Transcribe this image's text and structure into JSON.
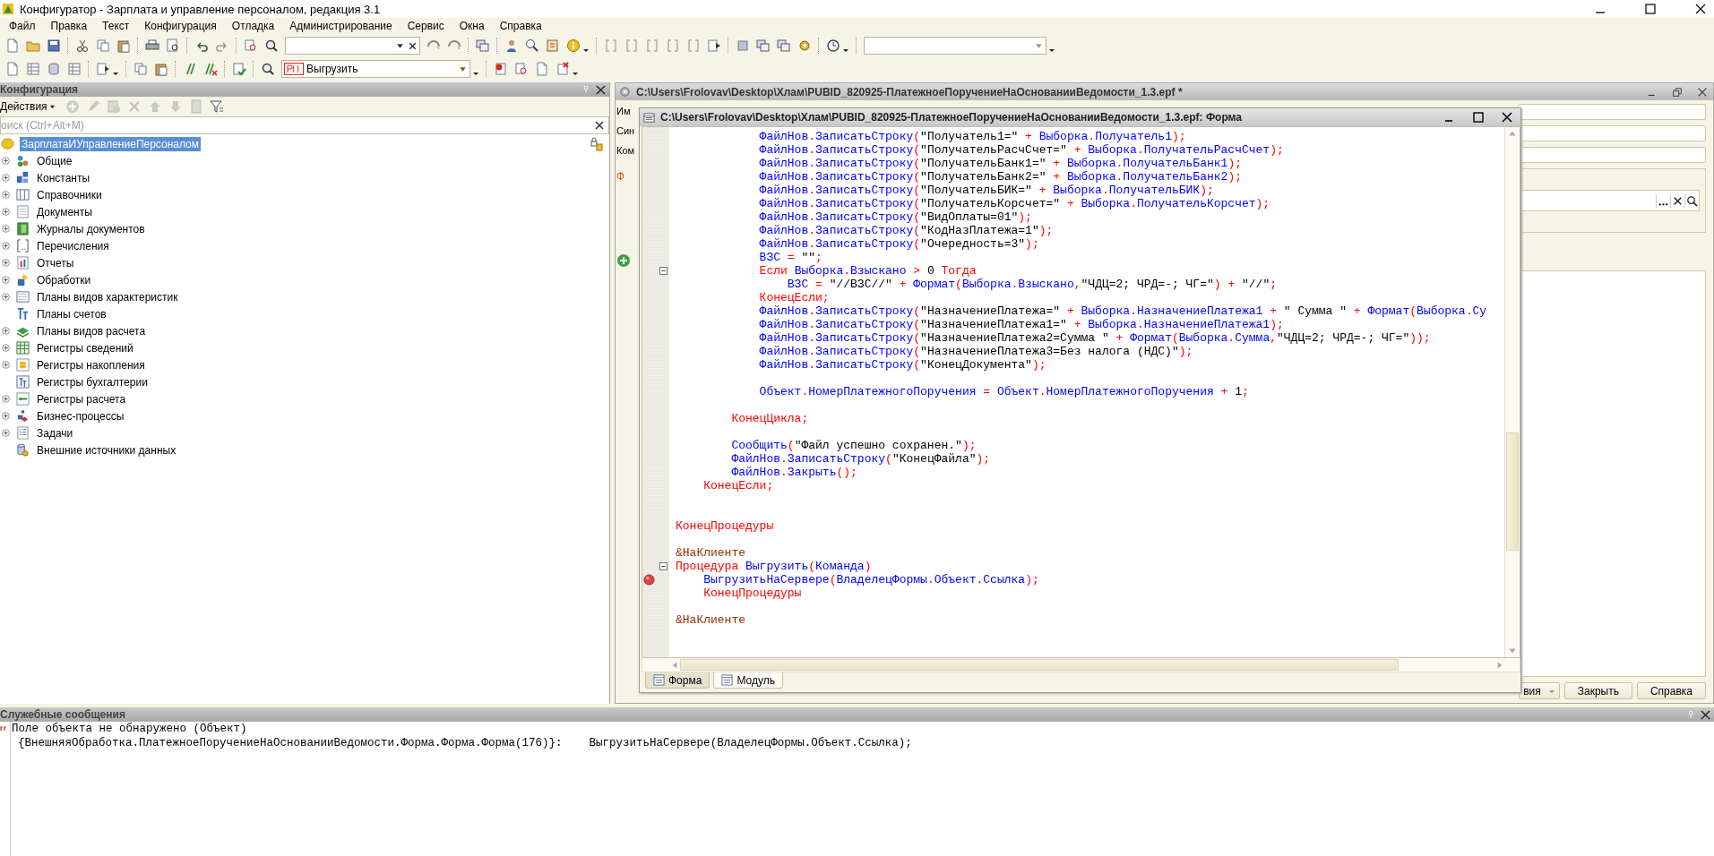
{
  "window": {
    "title": "Конфигуратор - Зарплата и управление персоналом, редакция 3.1"
  },
  "menu": [
    "Файл",
    "Правка",
    "Текст",
    "Конфигурация",
    "Отладка",
    "Администрирование",
    "Сервис",
    "Окна",
    "Справка"
  ],
  "toolbar": {
    "command_combo": {
      "value": "Выгрузить"
    }
  },
  "config_panel": {
    "title": "Конфигурация",
    "actions_label": "Действия",
    "search_placeholder": "оиск (Ctrl+Alt+M)",
    "tree": [
      {
        "label": "ЗарплатаИУправлениеПерсоналом",
        "selected": true,
        "children": [
          {
            "label": "Общие",
            "expandable": true,
            "selected": false
          },
          {
            "label": "Константы",
            "expandable": true,
            "selected": false
          },
          {
            "label": "Справочники",
            "expandable": true,
            "selected": false
          },
          {
            "label": "Документы",
            "expandable": true,
            "selected": false
          },
          {
            "label": "Журналы документов",
            "expandable": true,
            "selected": false
          },
          {
            "label": "Перечисления",
            "expandable": true,
            "selected": false
          },
          {
            "label": "Отчеты",
            "expandable": true,
            "selected": false
          },
          {
            "label": "Обработки",
            "expandable": true,
            "selected": false
          },
          {
            "label": "Планы видов характеристик",
            "expandable": true,
            "selected": false
          },
          {
            "label": "Планы счетов",
            "expandable": false,
            "selected": false
          },
          {
            "label": "Планы видов расчета",
            "expandable": true,
            "selected": false
          },
          {
            "label": "Регистры сведений",
            "expandable": true,
            "selected": false
          },
          {
            "label": "Регистры накопления",
            "expandable": true,
            "selected": false
          },
          {
            "label": "Регистры бухгалтерии",
            "expandable": false,
            "selected": false
          },
          {
            "label": "Регистры расчета",
            "expandable": true,
            "selected": false
          },
          {
            "label": "Бизнес-процессы",
            "expandable": true,
            "selected": false
          },
          {
            "label": "Задачи",
            "expandable": true,
            "selected": false
          },
          {
            "label": "Внешние источники данных",
            "expandable": false,
            "selected": false
          }
        ]
      }
    ]
  },
  "processing_window": {
    "title": "C:\\Users\\Frolovav\\Desktop\\Хлам\\PUBID_820925-ПлатежноеПоручениеНаОснованииВедомости_1.3.epf *",
    "labels": [
      "Им",
      "Син",
      "Ком"
    ],
    "group_title": "Ф",
    "buttons": [
      {
        "label": "вия",
        "kind": "dropdown"
      },
      {
        "label": "Закрыть",
        "kind": "plain"
      },
      {
        "label": "Справка",
        "kind": "plain"
      }
    ]
  },
  "module_window": {
    "title": "C:\\Users\\Frolovav\\Desktop\\Хлам\\PUBID_820925-ПлатежноеПоручениеНаОснованииВедомости_1.3.epf: Форма",
    "tabs": [
      {
        "label": "Форма",
        "selected": false
      },
      {
        "label": "Модуль",
        "selected": true
      }
    ],
    "code": [
      {
        "kind": "code",
        "tokens": [
          {
            "text": "            ФайлНов.ЗаписатьСтроку",
            "kind": "id"
          },
          {
            "text": "(",
            "kind": "op"
          },
          {
            "text": "\"Получатель1=\"",
            "kind": "str"
          },
          {
            "text": " + ",
            "kind": "op"
          },
          {
            "text": "Выборка.Получатель1",
            "kind": "id"
          },
          {
            "text": ");",
            "kind": "op"
          }
        ]
      },
      {
        "kind": "code",
        "tokens": [
          {
            "text": "            ФайлНов.ЗаписатьСтроку",
            "kind": "id"
          },
          {
            "text": "(",
            "kind": "op"
          },
          {
            "text": "\"ПолучательРасчСчет=\"",
            "kind": "str"
          },
          {
            "text": " + ",
            "kind": "op"
          },
          {
            "text": "Выборка.ПолучательРасчСчет",
            "kind": "id"
          },
          {
            "text": ");",
            "kind": "op"
          }
        ]
      },
      {
        "kind": "code",
        "tokens": [
          {
            "text": "            ФайлНов.ЗаписатьСтроку",
            "kind": "id"
          },
          {
            "text": "(",
            "kind": "op"
          },
          {
            "text": "\"ПолучательБанк1=\"",
            "kind": "str"
          },
          {
            "text": " + ",
            "kind": "op"
          },
          {
            "text": "Выборка.ПолучательБанк1",
            "kind": "id"
          },
          {
            "text": ");",
            "kind": "op"
          }
        ]
      },
      {
        "kind": "code",
        "tokens": [
          {
            "text": "            ФайлНов.ЗаписатьСтроку",
            "kind": "id"
          },
          {
            "text": "(",
            "kind": "op"
          },
          {
            "text": "\"ПолучательБанк2=\"",
            "kind": "str"
          },
          {
            "text": " + ",
            "kind": "op"
          },
          {
            "text": "Выборка.ПолучательБанк2",
            "kind": "id"
          },
          {
            "text": ");",
            "kind": "op"
          }
        ]
      },
      {
        "kind": "code",
        "tokens": [
          {
            "text": "            ФайлНов.ЗаписатьСтроку",
            "kind": "id"
          },
          {
            "text": "(",
            "kind": "op"
          },
          {
            "text": "\"ПолучательБИК=\"",
            "kind": "str"
          },
          {
            "text": " + ",
            "kind": "op"
          },
          {
            "text": "Выборка.ПолучательБИК",
            "kind": "id"
          },
          {
            "text": ");",
            "kind": "op"
          }
        ]
      },
      {
        "kind": "code",
        "tokens": [
          {
            "text": "            ФайлНов.ЗаписатьСтроку",
            "kind": "id"
          },
          {
            "text": "(",
            "kind": "op"
          },
          {
            "text": "\"ПолучательКорсчет=\"",
            "kind": "str"
          },
          {
            "text": " + ",
            "kind": "op"
          },
          {
            "text": "Выборка.ПолучательКорсчет",
            "kind": "id"
          },
          {
            "text": ");",
            "kind": "op"
          }
        ]
      },
      {
        "kind": "code",
        "tokens": [
          {
            "text": "            ФайлНов.ЗаписатьСтроку",
            "kind": "id"
          },
          {
            "text": "(",
            "kind": "op"
          },
          {
            "text": "\"ВидОплаты=01\"",
            "kind": "str"
          },
          {
            "text": ");",
            "kind": "op"
          }
        ]
      },
      {
        "kind": "code",
        "tokens": [
          {
            "text": "            ФайлНов.ЗаписатьСтроку",
            "kind": "id"
          },
          {
            "text": "(",
            "kind": "op"
          },
          {
            "text": "\"КодНазПлатежа=1\"",
            "kind": "str"
          },
          {
            "text": ");",
            "kind": "op"
          }
        ]
      },
      {
        "kind": "code",
        "tokens": [
          {
            "text": "            ФайлНов.ЗаписатьСтроку",
            "kind": "id"
          },
          {
            "text": "(",
            "kind": "op"
          },
          {
            "text": "\"Очередность=3\"",
            "kind": "str"
          },
          {
            "text": ");",
            "kind": "op"
          }
        ]
      },
      {
        "kind": "code",
        "tokens": [
          {
            "text": "            ВЗС",
            "kind": "id"
          },
          {
            "text": " = ",
            "kind": "op"
          },
          {
            "text": "\"\"",
            "kind": "str"
          },
          {
            "text": ";",
            "kind": "op"
          }
        ]
      },
      {
        "kind": "code",
        "collapsible": true,
        "tokens": [
          {
            "text": "            Если ",
            "kind": "kw"
          },
          {
            "text": "Выборка.Взыскано",
            "kind": "id"
          },
          {
            "text": " > ",
            "kind": "op"
          },
          {
            "text": "0",
            "kind": "num"
          },
          {
            "text": " Тогда",
            "kind": "kw"
          }
        ]
      },
      {
        "kind": "code",
        "tokens": [
          {
            "text": "                ВЗС",
            "kind": "id"
          },
          {
            "text": " = ",
            "kind": "op"
          },
          {
            "text": "\"//ВЗС//\"",
            "kind": "str"
          },
          {
            "text": " + ",
            "kind": "op"
          },
          {
            "text": "Формат",
            "kind": "id"
          },
          {
            "text": "(",
            "kind": "op"
          },
          {
            "text": "Выборка.Взыскано",
            "kind": "id"
          },
          {
            "text": ",",
            "kind": "op"
          },
          {
            "text": "\"ЧДЦ=2; ЧРД=-; ЧГ=\"",
            "kind": "str"
          },
          {
            "text": ") + ",
            "kind": "op"
          },
          {
            "text": "\"//\"",
            "kind": "str"
          },
          {
            "text": ";",
            "kind": "op"
          }
        ]
      },
      {
        "kind": "code",
        "tokens": [
          {
            "text": "            КонецЕсли;",
            "kind": "kw"
          }
        ]
      },
      {
        "kind": "code",
        "tokens": [
          {
            "text": "            ФайлНов.ЗаписатьСтроку",
            "kind": "id"
          },
          {
            "text": "(",
            "kind": "op"
          },
          {
            "text": "\"НазначениеПлатежа=\"",
            "kind": "str"
          },
          {
            "text": " + ",
            "kind": "op"
          },
          {
            "text": "Выборка.НазначениеПлатежа1",
            "kind": "id"
          },
          {
            "text": " + ",
            "kind": "op"
          },
          {
            "text": "\" Сумма \"",
            "kind": "str"
          },
          {
            "text": " + ",
            "kind": "op"
          },
          {
            "text": "Формат",
            "kind": "id"
          },
          {
            "text": "(",
            "kind": "op"
          },
          {
            "text": "Выборка.Су",
            "kind": "id"
          }
        ]
      },
      {
        "kind": "code",
        "tokens": [
          {
            "text": "            ФайлНов.ЗаписатьСтроку",
            "kind": "id"
          },
          {
            "text": "(",
            "kind": "op"
          },
          {
            "text": "\"НазначениеПлатежа1=\"",
            "kind": "str"
          },
          {
            "text": " + ",
            "kind": "op"
          },
          {
            "text": "Выборка.НазначениеПлатежа1",
            "kind": "id"
          },
          {
            "text": ");",
            "kind": "op"
          }
        ]
      },
      {
        "kind": "code",
        "tokens": [
          {
            "text": "            ФайлНов.ЗаписатьСтроку",
            "kind": "id"
          },
          {
            "text": "(",
            "kind": "op"
          },
          {
            "text": "\"НазначениеПлатежа2=Сумма \"",
            "kind": "str"
          },
          {
            "text": " + ",
            "kind": "op"
          },
          {
            "text": "Формат",
            "kind": "id"
          },
          {
            "text": "(",
            "kind": "op"
          },
          {
            "text": "Выборка.Сумма",
            "kind": "id"
          },
          {
            "text": ",",
            "kind": "op"
          },
          {
            "text": "\"ЧДЦ=2; ЧРД=-; ЧГ=\"",
            "kind": "str"
          },
          {
            "text": "));",
            "kind": "op"
          }
        ]
      },
      {
        "kind": "code",
        "tokens": [
          {
            "text": "            ФайлНов.ЗаписатьСтроку",
            "kind": "id"
          },
          {
            "text": "(",
            "kind": "op"
          },
          {
            "text": "\"НазначениеПлатежа3=Без налога (НДС)\"",
            "kind": "str"
          },
          {
            "text": ");",
            "kind": "op"
          }
        ]
      },
      {
        "kind": "code",
        "tokens": [
          {
            "text": "            ФайлНов.ЗаписатьСтроку",
            "kind": "id"
          },
          {
            "text": "(",
            "kind": "op"
          },
          {
            "text": "\"КонецДокумента\"",
            "kind": "str"
          },
          {
            "text": ");",
            "kind": "op"
          }
        ]
      },
      {
        "kind": "blank"
      },
      {
        "kind": "code",
        "tokens": [
          {
            "text": "            Объект.НомерПлатежногоПоручения",
            "kind": "id"
          },
          {
            "text": " = ",
            "kind": "op"
          },
          {
            "text": "Объект.НомерПлатежногоПоручения",
            "kind": "id"
          },
          {
            "text": " + ",
            "kind": "op"
          },
          {
            "text": "1",
            "kind": "num"
          },
          {
            "text": ";",
            "kind": "op"
          }
        ]
      },
      {
        "kind": "blank"
      },
      {
        "kind": "code",
        "tokens": [
          {
            "text": "        КонецЦикла;",
            "kind": "kw"
          }
        ]
      },
      {
        "kind": "blank"
      },
      {
        "kind": "code",
        "tokens": [
          {
            "text": "        Сообщить",
            "kind": "id"
          },
          {
            "text": "(",
            "kind": "op"
          },
          {
            "text": "\"Файл успешно сохранен.\"",
            "kind": "str"
          },
          {
            "text": ");",
            "kind": "op"
          }
        ]
      },
      {
        "kind": "code",
        "tokens": [
          {
            "text": "        ФайлНов.ЗаписатьСтроку",
            "kind": "id"
          },
          {
            "text": "(",
            "kind": "op"
          },
          {
            "text": "\"КонецФайла\"",
            "kind": "str"
          },
          {
            "text": ");",
            "kind": "op"
          }
        ]
      },
      {
        "kind": "code",
        "tokens": [
          {
            "text": "        ФайлНов.Закрыть",
            "kind": "id"
          },
          {
            "text": "();",
            "kind": "op"
          }
        ]
      },
      {
        "kind": "code",
        "tokens": [
          {
            "text": "    КонецЕсли;",
            "kind": "kw"
          }
        ]
      },
      {
        "kind": "blank"
      },
      {
        "kind": "blank"
      },
      {
        "kind": "code",
        "tokens": [
          {
            "text": "КонецПроцедуры",
            "kind": "kw"
          }
        ]
      },
      {
        "kind": "blank"
      },
      {
        "kind": "code",
        "tokens": [
          {
            "text": "&НаКлиенте",
            "kind": "dir"
          }
        ]
      },
      {
        "kind": "code",
        "collapsible": true,
        "tokens": [
          {
            "text": "Процедура ",
            "kind": "kw"
          },
          {
            "text": "Выгрузить",
            "kind": "id"
          },
          {
            "text": "(",
            "kind": "op"
          },
          {
            "text": "Команда",
            "kind": "id"
          },
          {
            "text": ")",
            "kind": "op"
          }
        ]
      },
      {
        "kind": "code",
        "breakpoint": true,
        "tokens": [
          {
            "text": "    ВыгрузитьНаСервере",
            "kind": "id"
          },
          {
            "text": "(",
            "kind": "op"
          },
          {
            "text": "ВладелецФормы.Объект.Ссылка",
            "kind": "id"
          },
          {
            "text": ");",
            "kind": "op"
          }
        ]
      },
      {
        "kind": "code",
        "tokens": [
          {
            "text": "    КонецПроцедуры",
            "kind": "kw"
          }
        ]
      },
      {
        "kind": "blank"
      },
      {
        "kind": "code",
        "tokens": [
          {
            "text": "&НаКлиенте",
            "kind": "dir"
          }
        ]
      }
    ]
  },
  "messages": {
    "title": "Служебные сообщения",
    "lines": [
      "Поле объекта не обнаружено (Объект)",
      "{ВнешняяОбработка.ПлатежноеПоручениеНаОснованииВедомости.Форма.Форма.Форма(176)}:    ВыгрузитьНаСервере(ВладелецФормы.Объект.Ссылка);"
    ]
  }
}
